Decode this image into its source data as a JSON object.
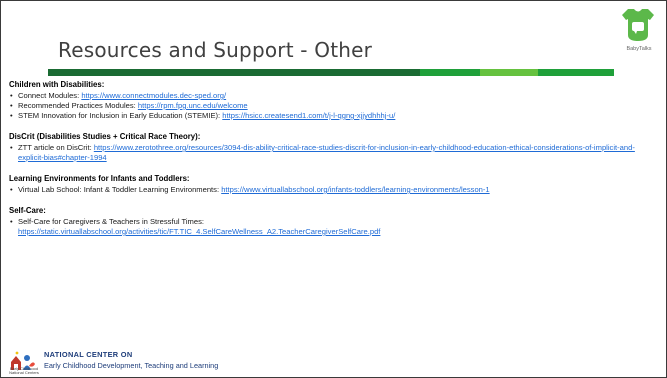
{
  "slide": {
    "title": "Resources and Support - Other",
    "logo_text": "BabyTalks",
    "bar_colors": [
      "#1a6b33",
      "#1fa03a",
      "#66c23f"
    ]
  },
  "sections": [
    {
      "heading": "Children with Disabilities:",
      "items": [
        {
          "label": "Connect Modules: ",
          "link": "https://www.connectmodules.dec-sped.org/"
        },
        {
          "label": "Recommended Practices Modules: ",
          "link": "https://rpm.fpg.unc.edu/welcome"
        },
        {
          "label": "STEM Innovation for Inclusion in Early Education (STEMIE): ",
          "link": "https://hsicc.createsend1.com/t/j-l-qgng-xjjydhhhj-u/"
        }
      ]
    },
    {
      "heading": "DisCrit (Disabilities Studies + Critical Race Theory):",
      "items": [
        {
          "label": "ZTT article on DisCrit: ",
          "link": "https://www.zerotothree.org/resources/3094-dis-ability-critical-race-studies-discrit-for-inclusion-in-early-childhood-education-ethical-considerations-of-implicit-and-explicit-bias#chapter-1994"
        }
      ]
    },
    {
      "heading": "Learning Environments for Infants and Toddlers:",
      "items": [
        {
          "label": "Virtual Lab School: Infant & Toddler Learning Environments: ",
          "link": "https://www.virtuallabschool.org/infants-toddlers/learning-environments/lesson-1"
        }
      ]
    },
    {
      "heading": "Self-Care:",
      "items": [
        {
          "label": "Self-Care for Caregivers & Teachers in Stressful Times: ",
          "link": "https://static.virtuallabschool.org/activities/tic/FT.TIC_4.SelfCareWellness_A2.TeacherCaregiverSelfCare.pdf"
        }
      ]
    }
  ],
  "footer": {
    "org_title": "NATIONAL CENTER ON",
    "org_subtitle": "Early Childhood Development, Teaching and Learning",
    "logo_caption": "Early Childhood National Centers"
  }
}
